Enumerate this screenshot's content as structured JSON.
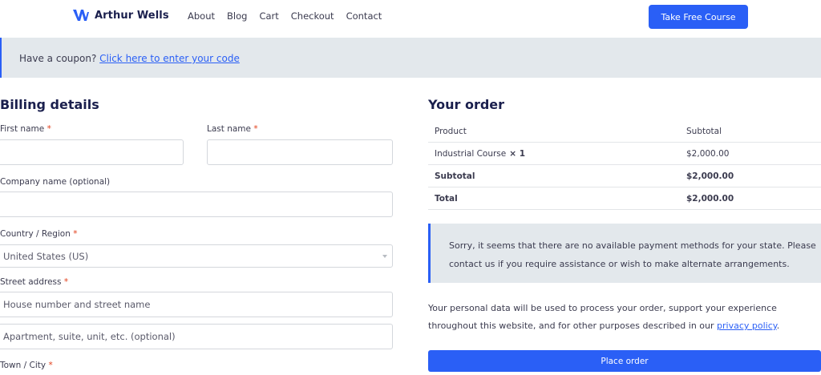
{
  "header": {
    "brand": "Arthur Wells",
    "nav": [
      "About",
      "Blog",
      "Cart",
      "Checkout",
      "Contact"
    ],
    "cta": "Take Free Course"
  },
  "coupon": {
    "prefix": "Have a coupon?",
    "link": "Click here to enter your code"
  },
  "billing": {
    "title": "Billing details",
    "first_name_label": "First name",
    "last_name_label": "Last name",
    "company_label": "Company name (optional)",
    "country_label": "Country / Region",
    "country_value": "United States (US)",
    "street_label": "Street address",
    "street_placeholder": "House number and street name",
    "apartment_placeholder": "Apartment, suite, unit, etc. (optional)",
    "town_label": "Town / City",
    "required_mark": "*"
  },
  "order": {
    "title": "Your order",
    "col_product": "Product",
    "col_subtotal": "Subtotal",
    "item_name": "Industrial Course",
    "item_qty": "× 1",
    "item_price": "$2,000.00",
    "subtotal_label": "Subtotal",
    "subtotal_value": "$2,000.00",
    "total_label": "Total",
    "total_value": "$2,000.00",
    "notice": "Sorry, it seems that there are no available payment methods for your state. Please contact us if you require assistance or wish to make alternate arrangements.",
    "privacy_text": "Your personal data will be used to process your order, support your experience throughout this website, and for other purposes described in our",
    "privacy_link": "privacy policy",
    "privacy_end": ".",
    "place_order": "Place order"
  },
  "colors": {
    "accent": "#2a5ff6",
    "navy": "#1a1f4d",
    "notice_bg": "#e3e8ec",
    "required": "#e2401c"
  }
}
